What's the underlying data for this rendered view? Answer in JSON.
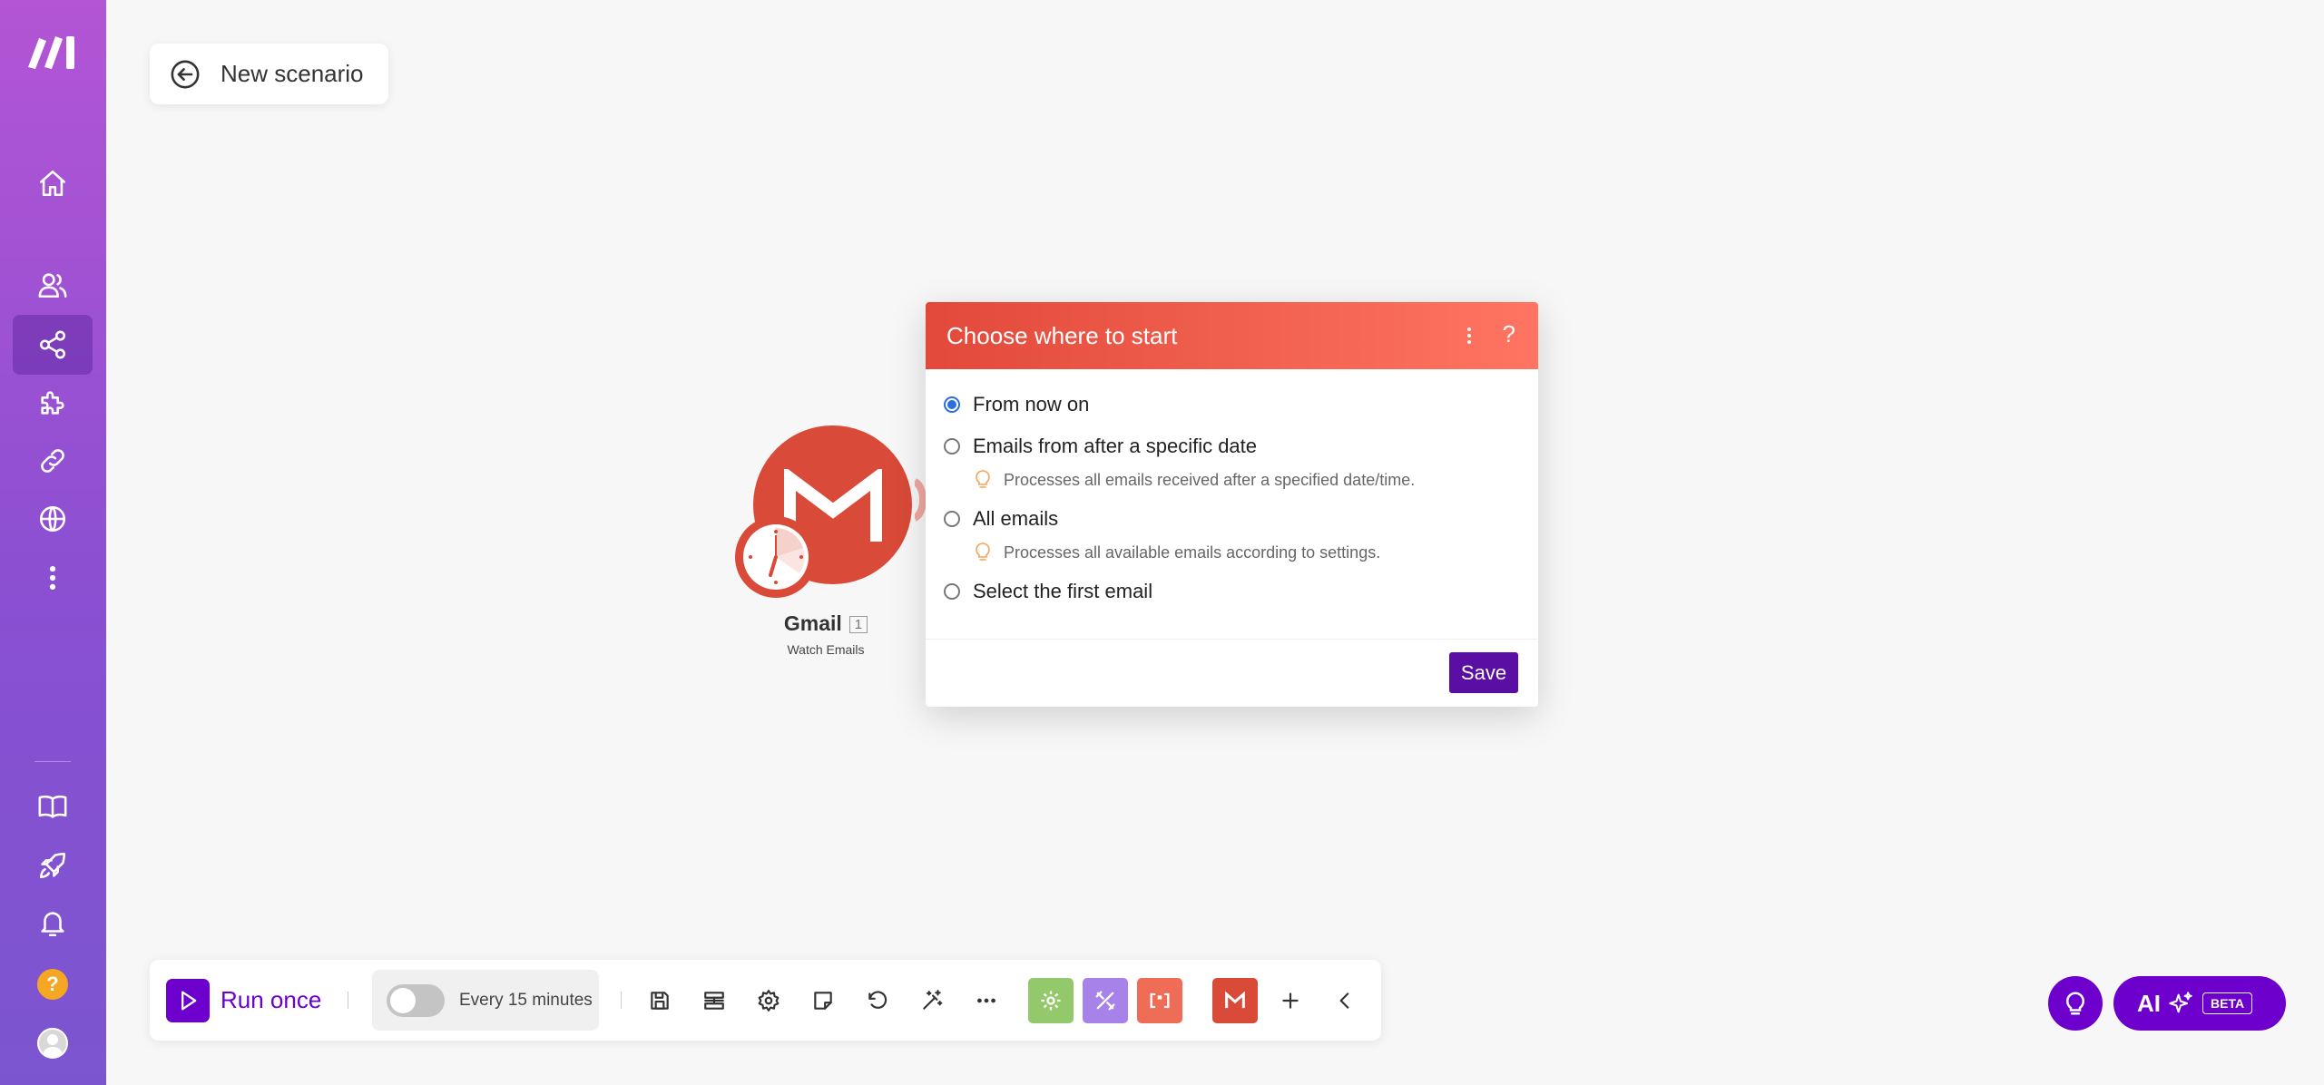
{
  "header": {
    "back_label": "New scenario"
  },
  "module": {
    "app_name": "Gmail",
    "index": "1",
    "action": "Watch Emails",
    "color": "#d94a38"
  },
  "dialog": {
    "title": "Choose where to start",
    "help": "?",
    "options": [
      {
        "label": "From now on",
        "checked": true
      },
      {
        "label": "Emails from after a specific date",
        "hint": "Processes all emails received after a specified date/time."
      },
      {
        "label": "All emails",
        "hint": "Processes all available emails according to settings."
      },
      {
        "label": "Select the first email"
      }
    ],
    "save_label": "Save"
  },
  "toolbar": {
    "run_label": "Run once",
    "schedule_label": "Every 15 minutes",
    "accent": "#6d00cc"
  },
  "assistant": {
    "ai_label": "AI",
    "beta_label": "BETA"
  }
}
